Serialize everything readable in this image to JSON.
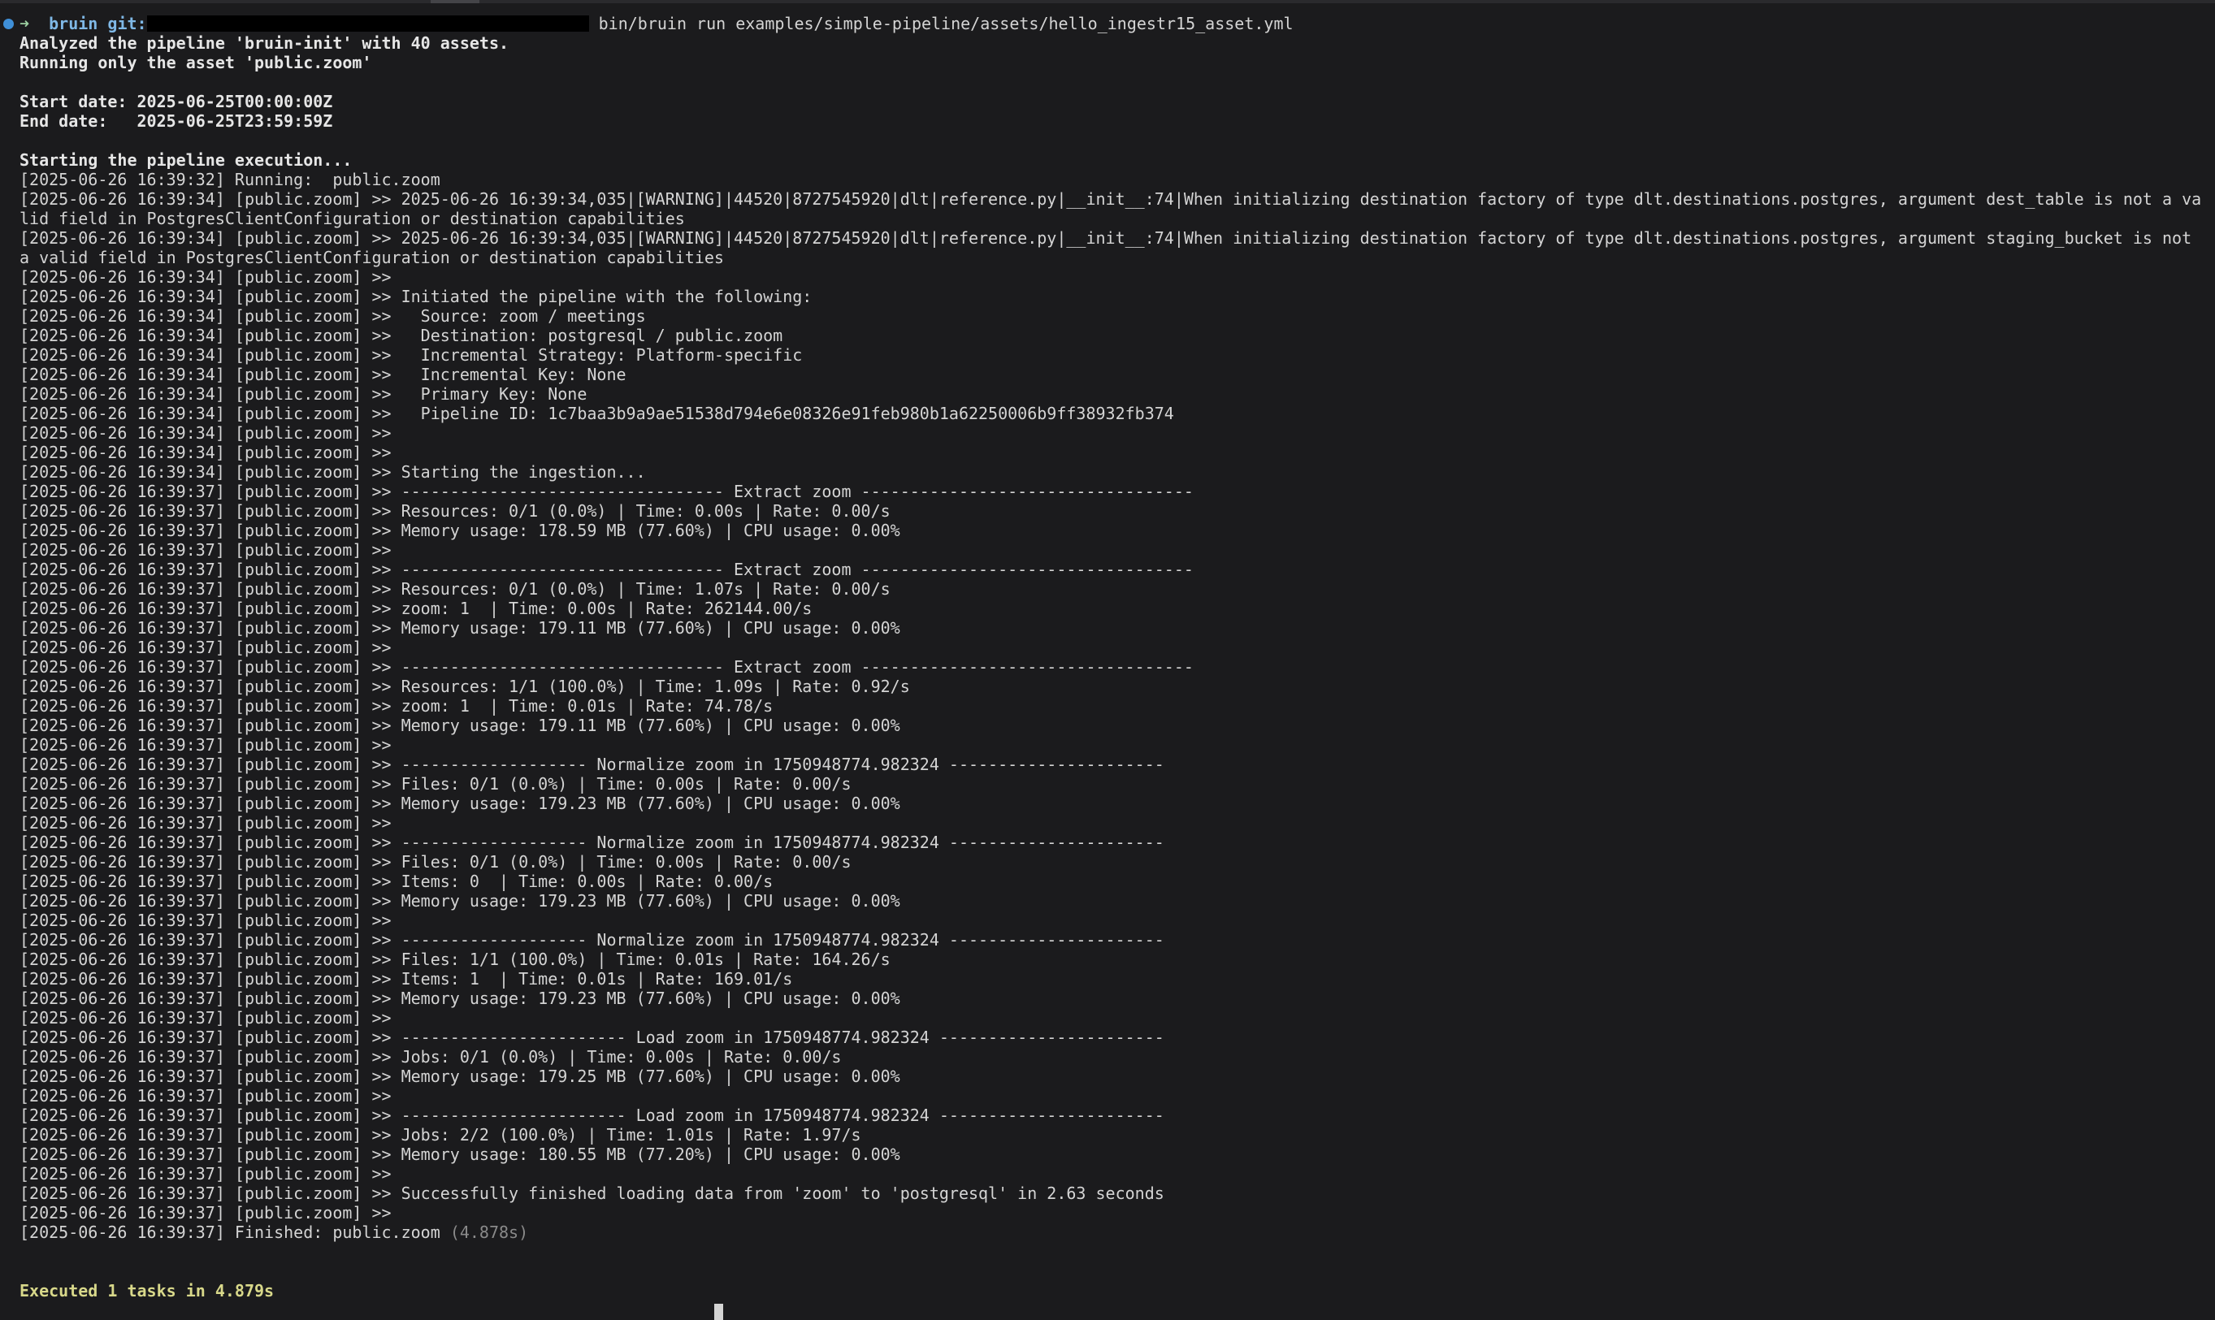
{
  "prompt": {
    "arrow": "➜",
    "dir": "bruin",
    "git_label": "git:",
    "command": "bin/bruin run examples/simple-pipeline/assets/hello_ingestr15_asset.yml"
  },
  "header_lines": [
    "Analyzed the pipeline 'bruin-init' with 40 assets.",
    "Running only the asset 'public.zoom'"
  ],
  "start_date": "Start date: 2025-06-25T00:00:00Z",
  "end_date": "End date:   2025-06-25T23:59:59Z",
  "starting": "Starting the pipeline execution...",
  "log_lines": [
    "[2025-06-26 16:39:32] Running:  public.zoom",
    "[2025-06-26 16:39:34] [public.zoom] >> 2025-06-26 16:39:34,035|[WARNING]|44520|8727545920|dlt|reference.py|__init__:74|When initializing destination factory of type dlt.destinations.postgres, argument dest_table is not a valid field in PostgresClientConfiguration or destination capabilities",
    "[2025-06-26 16:39:34] [public.zoom] >> 2025-06-26 16:39:34,035|[WARNING]|44520|8727545920|dlt|reference.py|__init__:74|When initializing destination factory of type dlt.destinations.postgres, argument staging_bucket is not a valid field in PostgresClientConfiguration or destination capabilities",
    "[2025-06-26 16:39:34] [public.zoom] >>",
    "[2025-06-26 16:39:34] [public.zoom] >> Initiated the pipeline with the following:",
    "[2025-06-26 16:39:34] [public.zoom] >>   Source: zoom / meetings",
    "[2025-06-26 16:39:34] [public.zoom] >>   Destination: postgresql / public.zoom",
    "[2025-06-26 16:39:34] [public.zoom] >>   Incremental Strategy: Platform-specific",
    "[2025-06-26 16:39:34] [public.zoom] >>   Incremental Key: None",
    "[2025-06-26 16:39:34] [public.zoom] >>   Primary Key: None",
    "[2025-06-26 16:39:34] [public.zoom] >>   Pipeline ID: 1c7baa3b9a9ae51538d794e6e08326e91feb980b1a62250006b9ff38932fb374",
    "[2025-06-26 16:39:34] [public.zoom] >>",
    "[2025-06-26 16:39:34] [public.zoom] >>",
    "[2025-06-26 16:39:34] [public.zoom] >> Starting the ingestion...",
    "[2025-06-26 16:39:37] [public.zoom] >> --------------------------------- Extract zoom ----------------------------------",
    "[2025-06-26 16:39:37] [public.zoom] >> Resources: 0/1 (0.0%) | Time: 0.00s | Rate: 0.00/s",
    "[2025-06-26 16:39:37] [public.zoom] >> Memory usage: 178.59 MB (77.60%) | CPU usage: 0.00%",
    "[2025-06-26 16:39:37] [public.zoom] >>",
    "[2025-06-26 16:39:37] [public.zoom] >> --------------------------------- Extract zoom ----------------------------------",
    "[2025-06-26 16:39:37] [public.zoom] >> Resources: 0/1 (0.0%) | Time: 1.07s | Rate: 0.00/s",
    "[2025-06-26 16:39:37] [public.zoom] >> zoom: 1  | Time: 0.00s | Rate: 262144.00/s",
    "[2025-06-26 16:39:37] [public.zoom] >> Memory usage: 179.11 MB (77.60%) | CPU usage: 0.00%",
    "[2025-06-26 16:39:37] [public.zoom] >>",
    "[2025-06-26 16:39:37] [public.zoom] >> --------------------------------- Extract zoom ----------------------------------",
    "[2025-06-26 16:39:37] [public.zoom] >> Resources: 1/1 (100.0%) | Time: 1.09s | Rate: 0.92/s",
    "[2025-06-26 16:39:37] [public.zoom] >> zoom: 1  | Time: 0.01s | Rate: 74.78/s",
    "[2025-06-26 16:39:37] [public.zoom] >> Memory usage: 179.11 MB (77.60%) | CPU usage: 0.00%",
    "[2025-06-26 16:39:37] [public.zoom] >>",
    "[2025-06-26 16:39:37] [public.zoom] >> ------------------- Normalize zoom in 1750948774.982324 ----------------------",
    "[2025-06-26 16:39:37] [public.zoom] >> Files: 0/1 (0.0%) | Time: 0.00s | Rate: 0.00/s",
    "[2025-06-26 16:39:37] [public.zoom] >> Memory usage: 179.23 MB (77.60%) | CPU usage: 0.00%",
    "[2025-06-26 16:39:37] [public.zoom] >>",
    "[2025-06-26 16:39:37] [public.zoom] >> ------------------- Normalize zoom in 1750948774.982324 ----------------------",
    "[2025-06-26 16:39:37] [public.zoom] >> Files: 0/1 (0.0%) | Time: 0.00s | Rate: 0.00/s",
    "[2025-06-26 16:39:37] [public.zoom] >> Items: 0  | Time: 0.00s | Rate: 0.00/s",
    "[2025-06-26 16:39:37] [public.zoom] >> Memory usage: 179.23 MB (77.60%) | CPU usage: 0.00%",
    "[2025-06-26 16:39:37] [public.zoom] >>",
    "[2025-06-26 16:39:37] [public.zoom] >> ------------------- Normalize zoom in 1750948774.982324 ----------------------",
    "[2025-06-26 16:39:37] [public.zoom] >> Files: 1/1 (100.0%) | Time: 0.01s | Rate: 164.26/s",
    "[2025-06-26 16:39:37] [public.zoom] >> Items: 1  | Time: 0.01s | Rate: 169.01/s",
    "[2025-06-26 16:39:37] [public.zoom] >> Memory usage: 179.23 MB (77.60%) | CPU usage: 0.00%",
    "[2025-06-26 16:39:37] [public.zoom] >>",
    "[2025-06-26 16:39:37] [public.zoom] >> ----------------------- Load zoom in 1750948774.982324 -----------------------",
    "[2025-06-26 16:39:37] [public.zoom] >> Jobs: 0/1 (0.0%) | Time: 0.00s | Rate: 0.00/s",
    "[2025-06-26 16:39:37] [public.zoom] >> Memory usage: 179.25 MB (77.60%) | CPU usage: 0.00%",
    "[2025-06-26 16:39:37] [public.zoom] >>",
    "[2025-06-26 16:39:37] [public.zoom] >> ----------------------- Load zoom in 1750948774.982324 -----------------------",
    "[2025-06-26 16:39:37] [public.zoom] >> Jobs: 2/2 (100.0%) | Time: 1.01s | Rate: 1.97/s",
    "[2025-06-26 16:39:37] [public.zoom] >> Memory usage: 180.55 MB (77.20%) | CPU usage: 0.00%",
    "[2025-06-26 16:39:37] [public.zoom] >>",
    "[2025-06-26 16:39:37] [public.zoom] >> Successfully finished loading data from 'zoom' to 'postgresql' in 2.63 seconds",
    "[2025-06-26 16:39:37] [public.zoom] >>"
  ],
  "finished": {
    "text": "[2025-06-26 16:39:37] Finished: public.zoom",
    "duration": "(4.878s)"
  },
  "summary": "Executed 1 tasks in 4.879s",
  "colors": {
    "background": "#1b1b1d",
    "text": "#d4d4d4",
    "prompt_dot": "#3f8fd8",
    "summary": "#d8d88a"
  }
}
